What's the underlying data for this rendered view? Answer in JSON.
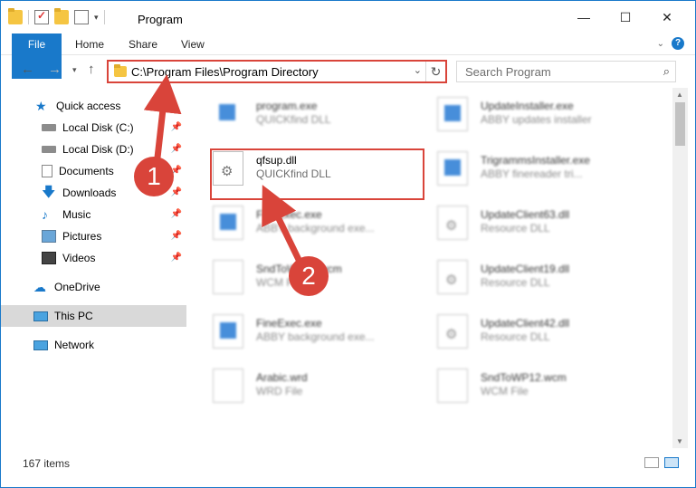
{
  "window": {
    "title": "Program",
    "controls": {
      "minimize": "—",
      "maximize": "☐",
      "close": "✕"
    }
  },
  "ribbon": {
    "tabs": [
      "File",
      "Home",
      "Share",
      "View"
    ]
  },
  "address_bar": {
    "path": "C:\\Program Files\\Program Directory",
    "search_placeholder": "Search Program"
  },
  "sidebar": {
    "items": [
      {
        "label": "Quick access",
        "icon": "star-icon",
        "pinned": false
      },
      {
        "label": "Local Disk (C:)",
        "icon": "drive-icon",
        "pinned": true
      },
      {
        "label": "Local Disk (D:)",
        "icon": "drive-icon",
        "pinned": true
      },
      {
        "label": "Documents",
        "icon": "documents-icon",
        "pinned": true
      },
      {
        "label": "Downloads",
        "icon": "download-icon",
        "pinned": true
      },
      {
        "label": "Music",
        "icon": "music-icon",
        "pinned": true
      },
      {
        "label": "Pictures",
        "icon": "pictures-icon",
        "pinned": true
      },
      {
        "label": "Videos",
        "icon": "videos-icon",
        "pinned": true
      },
      {
        "label": "OneDrive",
        "icon": "cloud-icon",
        "pinned": false
      },
      {
        "label": "This PC",
        "icon": "computer-icon",
        "pinned": false,
        "selected": true
      },
      {
        "label": "Network",
        "icon": "network-icon",
        "pinned": false
      }
    ]
  },
  "files": [
    {
      "name": "program.exe",
      "desc": "QUICKfind DLL",
      "icon": "installer-icon"
    },
    {
      "name": "UpdateInstaller.exe",
      "desc": "ABBY updates installer",
      "icon": "exe-icon"
    },
    {
      "name": "qfsup.dll",
      "desc": "QUICKfind DLL",
      "icon": "dll-gear-icon",
      "highlighted": true
    },
    {
      "name": "TrigrammsInstaller.exe",
      "desc": "ABBY finereader tri...",
      "icon": "exe-icon"
    },
    {
      "name": "FineExec.exe",
      "desc": "ABBY background exe...",
      "icon": "exe-icon"
    },
    {
      "name": "UpdateClient63.dll",
      "desc": "Resource DLL",
      "icon": "dll-gear-icon"
    },
    {
      "name": "SndToWP12.wcm",
      "desc": "WCM File",
      "icon": "doc-icon"
    },
    {
      "name": "UpdateClient19.dll",
      "desc": "Resource DLL",
      "icon": "dll-gear-icon"
    },
    {
      "name": "FineExec.exe",
      "desc": "ABBY background exe...",
      "icon": "exe-icon"
    },
    {
      "name": "UpdateClient42.dll",
      "desc": "Resource DLL",
      "icon": "dll-gear-icon"
    },
    {
      "name": "Arabic.wrd",
      "desc": "WRD File",
      "icon": "doc-icon"
    },
    {
      "name": "SndToWP12.wcm",
      "desc": "WCM File",
      "icon": "doc-icon"
    }
  ],
  "status": {
    "item_count": "167 items"
  },
  "annotations": {
    "step1": "1",
    "step2": "2"
  },
  "colors": {
    "accent": "#1979ca",
    "highlight": "#d9443a"
  }
}
